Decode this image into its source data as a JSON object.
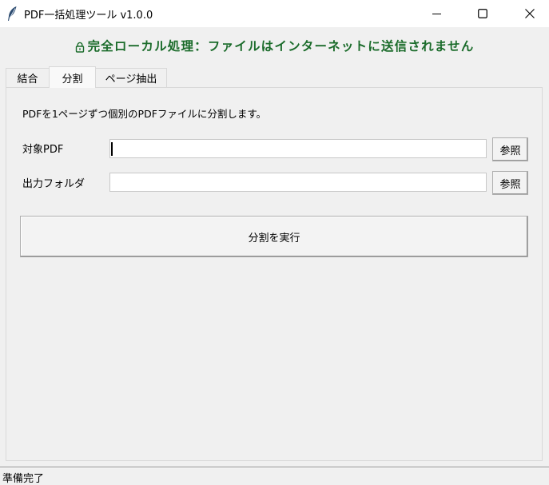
{
  "window": {
    "title": "PDF一括処理ツール v1.0.0",
    "app_icon": "feather-icon",
    "controls": {
      "minimize_icon": "minimize-icon",
      "maximize_icon": "maximize-icon",
      "close_icon": "close-icon"
    }
  },
  "banner": {
    "icon": "lock-icon",
    "text": "完全ローカル処理：ファイルはインターネットに送信されません",
    "color": "#1a6b2a"
  },
  "tabs": [
    {
      "label": "結合",
      "active": false
    },
    {
      "label": "分割",
      "active": true
    },
    {
      "label": "ページ抽出",
      "active": false
    }
  ],
  "split_panel": {
    "description": "PDFを1ページずつ個別のPDFファイルに分割します。",
    "target_pdf": {
      "label": "対象PDF",
      "value": "",
      "browse_label": "参照"
    },
    "output_folder": {
      "label": "出力フォルダ",
      "value": "",
      "browse_label": "参照"
    },
    "run_label": "分割を実行"
  },
  "status": {
    "text": "準備完了"
  }
}
